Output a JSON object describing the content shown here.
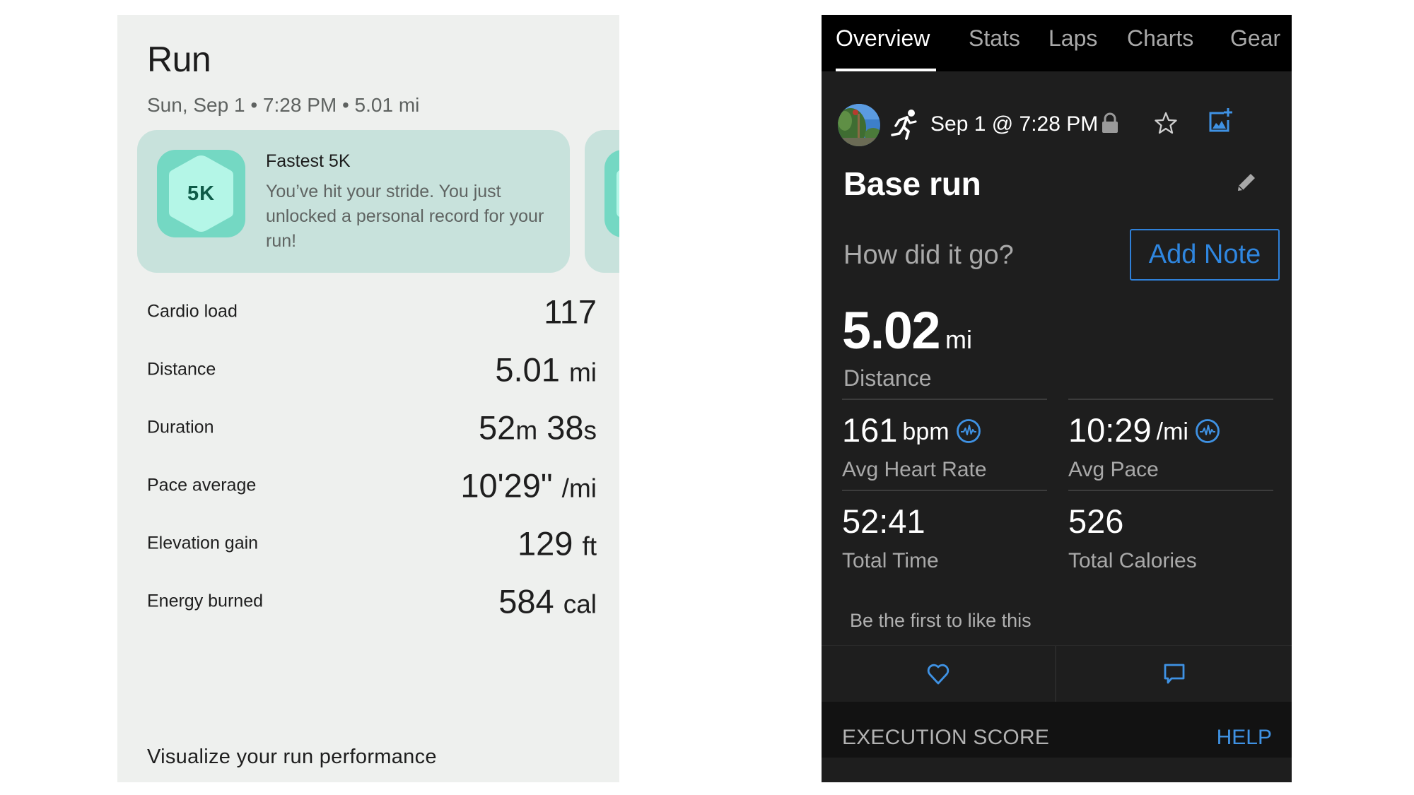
{
  "left_app": {
    "title": "Run",
    "subtitle": "Sun, Sep 1 • 7:28 PM • 5.01 mi",
    "achievement": {
      "badge_text": "5K",
      "title": "Fastest 5K",
      "body": "You’ve hit your stride. You just unlocked a personal record for your run!"
    },
    "metrics": [
      {
        "label": "Cardio load",
        "value": "117",
        "unit": ""
      },
      {
        "label": "Distance",
        "value": "5.01",
        "unit": "mi"
      },
      {
        "label": "Duration",
        "value_parts": [
          "52",
          "m",
          " 38",
          "s"
        ]
      },
      {
        "label": "Pace average",
        "value": "10'29\"",
        "unit": "/mi"
      },
      {
        "label": "Elevation gain",
        "value": "129",
        "unit": "ft"
      },
      {
        "label": "Energy burned",
        "value": "584",
        "unit": "cal"
      }
    ],
    "footer_heading": "Visualize your run performance"
  },
  "right_app": {
    "tabs": [
      {
        "label": "Overview",
        "active": true
      },
      {
        "label": "Stats",
        "active": false
      },
      {
        "label": "Laps",
        "active": false
      },
      {
        "label": "Charts",
        "active": false
      },
      {
        "label": "Gear",
        "active": false
      }
    ],
    "activity": {
      "date": "Sep 1 @ 7:28 PM",
      "type_icon": "running-icon",
      "title": "Base run",
      "prompt": "How did it go?",
      "add_note_label": "Add Note"
    },
    "distance": {
      "value": "5.02",
      "unit": "mi",
      "label": "Distance"
    },
    "stats": [
      {
        "value": "161",
        "unit": "bpm",
        "label": "Avg Heart Rate",
        "icon": "heart-rate-chart-icon"
      },
      {
        "value": "10:29",
        "unit": "/mi",
        "label": "Avg Pace",
        "icon": "pace-chart-icon"
      },
      {
        "value": "52:41",
        "unit": "",
        "label": "Total Time"
      },
      {
        "value": "526",
        "unit": "",
        "label": "Total Calories"
      }
    ],
    "social": {
      "likes_text": "Be the first to like this"
    },
    "execution": {
      "title": "EXECUTION SCORE",
      "help_label": "HELP"
    },
    "colors": {
      "accent_blue": "#2f86df",
      "badge_teal": "#74d8c3"
    }
  }
}
